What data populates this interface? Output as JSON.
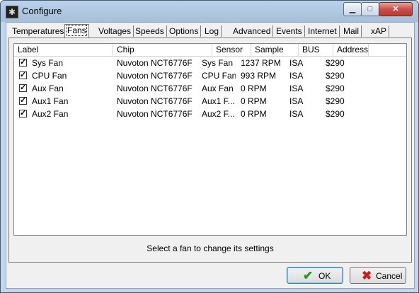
{
  "window": {
    "title": "Configure",
    "minimize": "▁",
    "maximize": "□",
    "close": "✕"
  },
  "tabs": [
    "Temperatures",
    "Fans",
    "Voltages",
    "Speeds",
    "Options",
    "Log",
    "Advanced",
    "Events",
    "Internet",
    "Mail",
    "xAP"
  ],
  "active_tab": "Fans",
  "list": {
    "columns": [
      "Label",
      "Chip",
      "Sensor",
      "Sample",
      "BUS",
      "Address"
    ],
    "rows": [
      {
        "checked": true,
        "label": "Sys Fan",
        "chip": "Nuvoton NCT6776F",
        "sensor": "Sys Fan",
        "sample": "1237 RPM",
        "bus": "ISA",
        "address": "$290"
      },
      {
        "checked": true,
        "label": "CPU Fan",
        "chip": "Nuvoton NCT6776F",
        "sensor": "CPU Fan",
        "sample": "993 RPM",
        "bus": "ISA",
        "address": "$290"
      },
      {
        "checked": true,
        "label": "Aux Fan",
        "chip": "Nuvoton NCT6776F",
        "sensor": "Aux Fan",
        "sample": "0 RPM",
        "bus": "ISA",
        "address": "$290"
      },
      {
        "checked": true,
        "label": "Aux1 Fan",
        "chip": "Nuvoton NCT6776F",
        "sensor": "Aux1 F...",
        "sample": "0 RPM",
        "bus": "ISA",
        "address": "$290"
      },
      {
        "checked": true,
        "label": "Aux2 Fan",
        "chip": "Nuvoton NCT6776F",
        "sensor": "Aux2 F...",
        "sample": "0 RPM",
        "bus": "ISA",
        "address": "$290"
      }
    ]
  },
  "status_text": "Select a fan to change its settings",
  "buttons": {
    "ok": "OK",
    "cancel": "Cancel"
  }
}
